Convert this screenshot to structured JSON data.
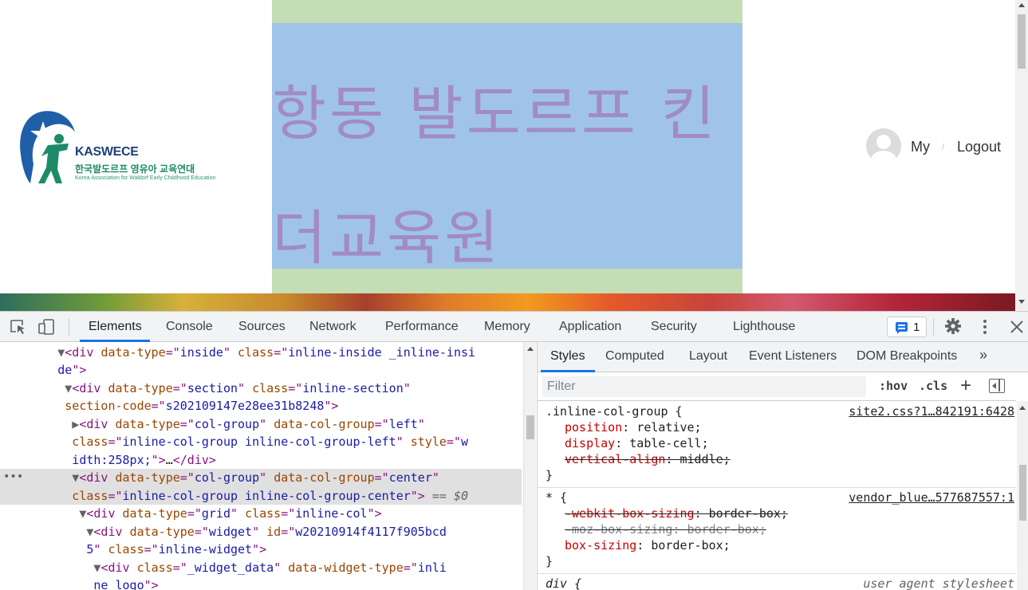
{
  "site": {
    "logo": {
      "brand": "KASWECE",
      "korean_name": "한국발도르프 영유아 교육연대",
      "english_name": "Korea Association for Waldorf Early Childhood Education"
    },
    "center_text": "항동 발도르프 킨더교육원",
    "user_menu": {
      "my_label": "My",
      "separator": "/",
      "logout_label": "Logout"
    }
  },
  "devtools": {
    "tabs": [
      "Elements",
      "Console",
      "Sources",
      "Network",
      "Performance",
      "Memory",
      "Application",
      "Security",
      "Lighthouse"
    ],
    "active_tab": "Elements",
    "issues_count": "1",
    "styles_tabs": [
      "Styles",
      "Computed",
      "Layout",
      "Event Listeners",
      "DOM Breakpoints"
    ],
    "filter_placeholder": "Filter",
    "hov_label": ":hov",
    "cls_label": ".cls",
    "plus_label": "+",
    "dom_selected_marker": "== $0",
    "rules": [
      {
        "selector": ".inline-col-group {",
        "source": "site2.css?1…842191:6428",
        "props": [
          {
            "name": "position",
            "value": "relative;"
          },
          {
            "name": "display",
            "value": "table-cell;"
          },
          {
            "name": "vertical-align",
            "value": "middle;"
          }
        ]
      },
      {
        "selector": "* {",
        "source": "vendor_blue…577687557:1",
        "props": [
          {
            "name": "-webkit-box-sizing",
            "value": "border-box;"
          },
          {
            "name": "-moz-box-sizing",
            "value": "border-box;"
          },
          {
            "name": "box-sizing",
            "value": "border-box;"
          }
        ]
      },
      {
        "selector": "div {",
        "source": "user agent stylesheet",
        "props": []
      }
    ],
    "closing_brace": "}"
  }
}
